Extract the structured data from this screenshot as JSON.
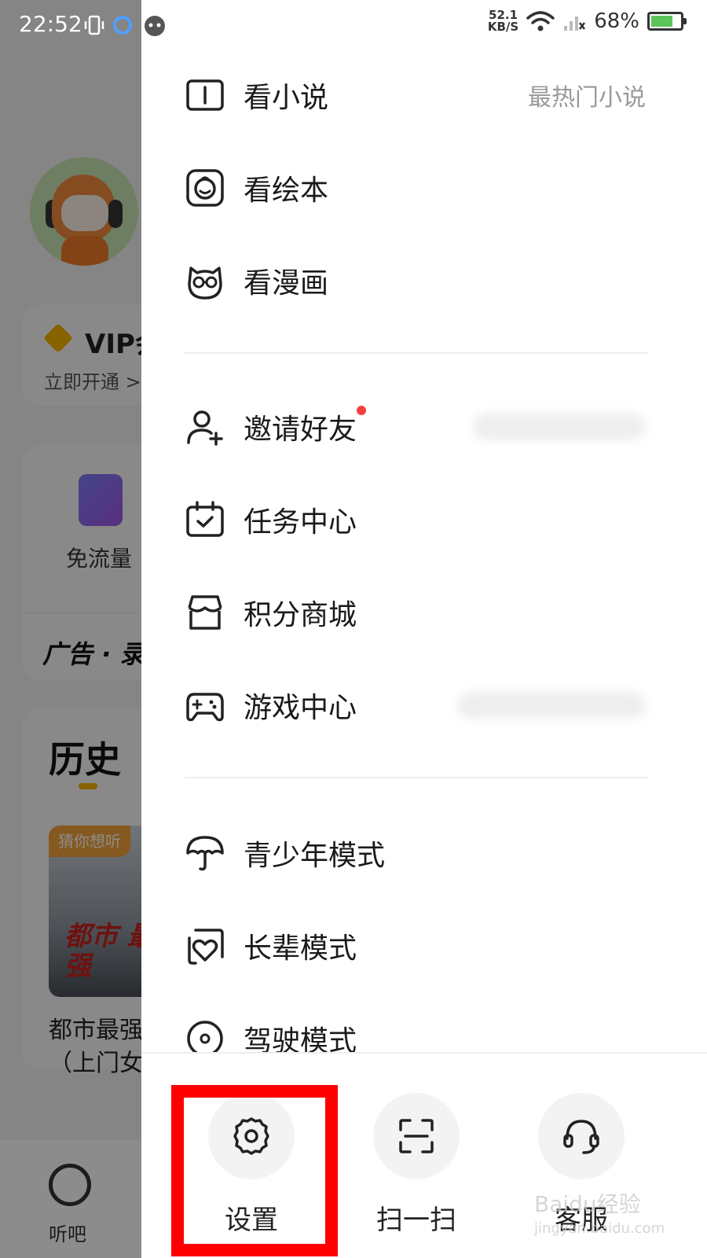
{
  "status_bar": {
    "time": "22:52",
    "net_speed_value": "52.1",
    "net_speed_unit": "KB/S",
    "battery": "68%"
  },
  "background_app": {
    "vip_title": "VIP会",
    "vip_sub": "立即开通 >",
    "free_data_label": "免流量",
    "ad_label": "广告 · 录",
    "history_title": "历史",
    "history_badge": "猜你想听",
    "history_cover_text": "都市 最强",
    "history_item_line1": "都市最强",
    "history_item_line2": "（上门女",
    "tab_label": "听吧"
  },
  "drawer": {
    "menu_group1": [
      {
        "label": "看小说",
        "hint": "最热门小说"
      },
      {
        "label": "看绘本"
      },
      {
        "label": "看漫画"
      }
    ],
    "menu_group2": [
      {
        "label": "邀请好友"
      },
      {
        "label": "任务中心"
      },
      {
        "label": "积分商城"
      },
      {
        "label": "游戏中心"
      }
    ],
    "menu_group3": [
      {
        "label": "青少年模式"
      },
      {
        "label": "长辈模式"
      },
      {
        "label": "驾驶模式"
      }
    ],
    "bottom_actions": [
      {
        "label": "设置",
        "icon": "gear-icon"
      },
      {
        "label": "扫一扫",
        "icon": "scan-icon"
      },
      {
        "label": "客服",
        "icon": "headset-icon"
      }
    ]
  },
  "watermark": {
    "text": "Baidu经验",
    "sub": "jingyan.baidu.com"
  },
  "colors": {
    "highlight": "#ff0000",
    "accent": "#f6b400",
    "red_dot": "#f04040"
  }
}
